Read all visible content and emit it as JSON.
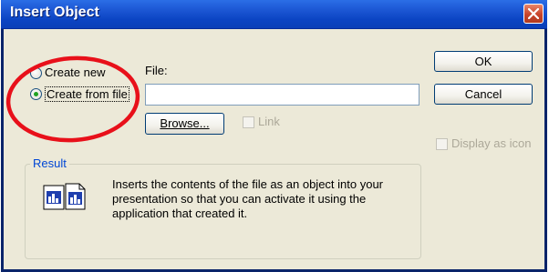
{
  "dialog": {
    "title": "Insert Object",
    "close_icon": "close-icon"
  },
  "options": {
    "create_new_label": "Create new",
    "create_from_file_label": "Create from file",
    "selected": "Create from file"
  },
  "file": {
    "label": "File:",
    "value": "",
    "browse_label": "Browse...",
    "link_label": "Link",
    "link_checked": false
  },
  "buttons": {
    "ok_label": "OK",
    "cancel_label": "Cancel"
  },
  "display_as_icon": {
    "label": "Display as icon",
    "checked": false,
    "enabled": false
  },
  "result": {
    "title": "Result",
    "text": "Inserts the contents of the file as an object into your presentation so that you can activate it using the application that created it.",
    "icon": "document-object-icon"
  },
  "colors": {
    "title_bar": "#0a3fb8",
    "dialog_bg": "#ece9d8",
    "annotation_ellipse": "#e8101a",
    "radio_dot": "#21a121"
  }
}
